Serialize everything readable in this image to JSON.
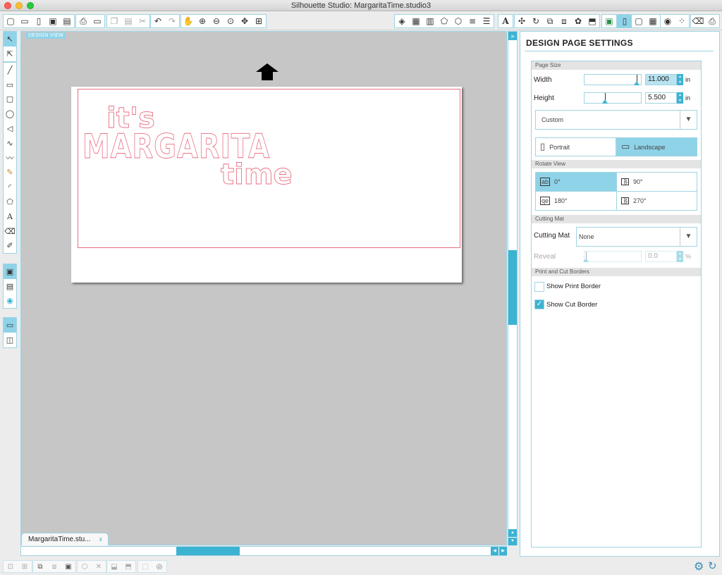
{
  "window": {
    "title": "Silhouette Studio: MargaritaTime.studio3"
  },
  "canvas": {
    "view_label": "DESIGN VIEW",
    "design_text": {
      "line1": "it's",
      "line2": "MARGARITA",
      "line3": "time"
    }
  },
  "document_tab": {
    "label": "MargaritaTime.stu...",
    "close": "x"
  },
  "panel": {
    "expand_glyph": "»",
    "title": "DESIGN PAGE SETTINGS",
    "page_size": {
      "section": "Page Size",
      "width_label": "Width",
      "width_value": "11.000",
      "width_unit": "in",
      "height_label": "Height",
      "height_value": "5.500",
      "height_unit": "in",
      "preset": "Custom",
      "portrait_label": "Portrait",
      "landscape_label": "Landscape",
      "selected_orientation": "Landscape"
    },
    "rotate_view": {
      "section": "Rotate View",
      "options": [
        "0°",
        "90°",
        "180°",
        "270°"
      ],
      "selected": "0°",
      "badges": [
        "ab",
        "ab",
        "qe",
        "ab"
      ]
    },
    "cutting_mat": {
      "section": "Cutting Mat",
      "label": "Cutting Mat",
      "value": "None",
      "reveal_label": "Reveal",
      "reveal_value": "0.0",
      "reveal_unit": "%"
    },
    "borders": {
      "section": "Print and Cut Borders",
      "show_print_border": "Show Print Border",
      "show_print_border_checked": false,
      "show_cut_border": "Show Cut Border",
      "show_cut_border_checked": true
    }
  },
  "icons": {
    "toolbar_groups": [
      [
        "new-document",
        "open",
        "open-library",
        "save",
        "save-to-library"
      ],
      [
        "print",
        "send-to-silhouette"
      ],
      [
        "copy",
        "paste",
        "cut"
      ],
      [
        "undo",
        "redo"
      ],
      [
        "pan",
        "zoom-in",
        "zoom-out",
        "zoom-select",
        "drag-zoom",
        "fit-to-page"
      ],
      [
        "fill",
        "line-style",
        "grid",
        "page-shape",
        "replicate",
        "align-lines",
        "offset"
      ],
      [
        "text-style"
      ],
      [
        "transform",
        "rotate",
        "replicate-panel",
        "modify",
        "trace",
        "library-store"
      ],
      [
        "page-setup",
        "cut-settings",
        "grid-panel"
      ],
      [
        "registration",
        "design-page-settings"
      ],
      [
        "eraser",
        "send-panel"
      ]
    ],
    "left_groups": [
      [
        "select-tool",
        "point-edit-tool"
      ],
      [
        "line-tool",
        "rectangle-tool",
        "rounded-rectangle-tool",
        "ellipse-tool",
        "polygon-tool",
        "curve-tool",
        "freehand-tool",
        "smooth-freehand-tool",
        "arc-tool",
        "regular-polygon-tool",
        "text-tool",
        "eraser-tool",
        "knife-tool"
      ],
      [
        "page-view",
        "library-view",
        "store-view"
      ],
      [
        "design-view-layout",
        "split-view-layout"
      ]
    ],
    "bottom_groups": [
      [
        "group",
        "ungroup"
      ],
      [
        "compound-path",
        "release-compound",
        "bring-to-front"
      ],
      [
        "weld",
        "subtract"
      ],
      [
        "send-backward",
        "bring-forward"
      ],
      [
        "library-add",
        "registration-mark"
      ]
    ]
  },
  "colors": {
    "accent": "#3db3d2",
    "selection": "#8fd3e8",
    "cut_line": "#e86f80",
    "canvas_bg": "#c6c6c6"
  }
}
